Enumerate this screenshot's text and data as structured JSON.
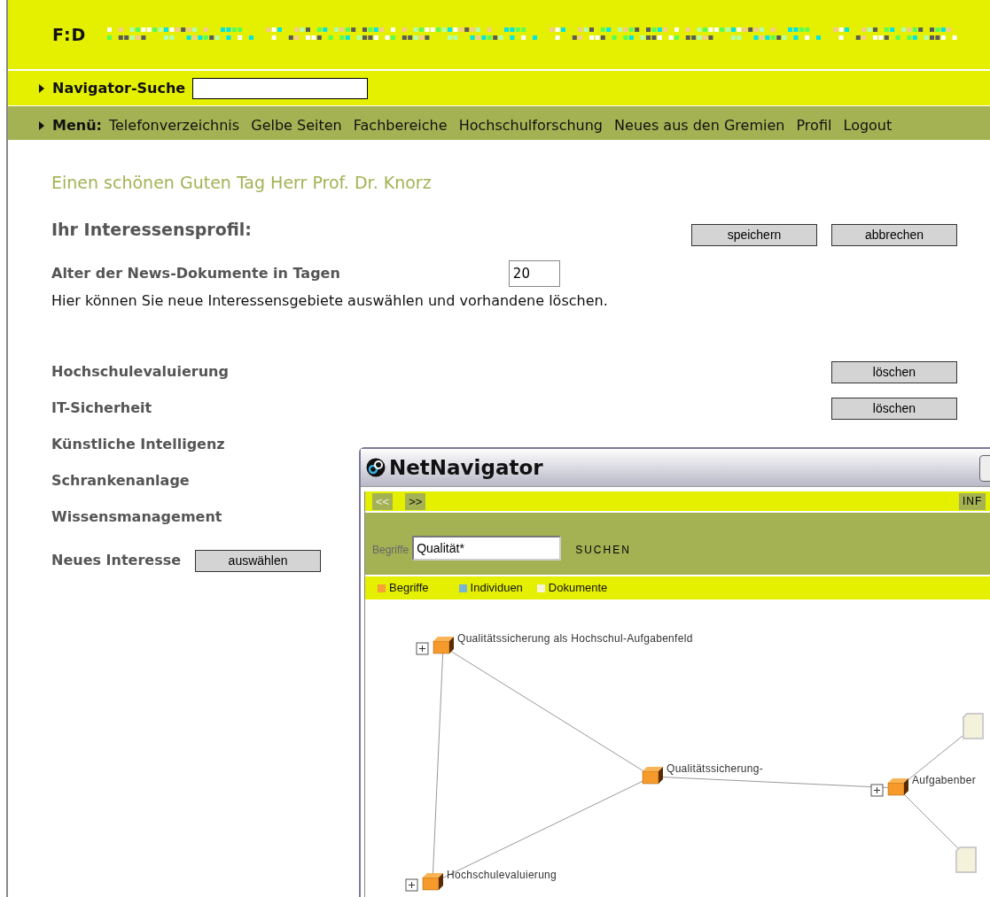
{
  "header": {
    "logo": "F:D"
  },
  "navigator_search": {
    "label": "Navigator-Suche"
  },
  "menu": {
    "label": "Menü:",
    "items": [
      "Telefonverzeichnis",
      "Gelbe Seiten",
      "Fachbereiche",
      "Hochschulforschung",
      "Neues aus den Gremien",
      "Profil",
      "Logout"
    ]
  },
  "greeting": "Einen schönen Guten Tag Herr Prof. Dr. Knorz",
  "profile": {
    "title": "Ihr Interessensprofil:",
    "buttons": [
      "speichern",
      "abbrechen"
    ],
    "age_label": "Alter der News-Dokumente in Tagen",
    "age_value": "20",
    "hint": "Hier können Sie neue Interessensgebiete auswählen und vorhandene löschen.",
    "interests": [
      {
        "label": "Hochschulevaluierung",
        "button": "löschen"
      },
      {
        "label": "IT-Sicherheit",
        "button": "löschen"
      },
      {
        "label": "Künstliche Intelligenz"
      },
      {
        "label": "Schrankenanlage"
      },
      {
        "label": "Wissensmanagement"
      }
    ],
    "new_label": "Neues Interesse",
    "new_button": "auswählen"
  },
  "net_navigator": {
    "title": "NetNavigator",
    "nav_buttons": [
      "<<",
      ">>"
    ],
    "info_button": "INF",
    "search_label": "Begriffe",
    "search_value": "Qualität*",
    "search_button": "SUCHEN",
    "legend": [
      {
        "label": "Begriffe",
        "color": "#f7a035"
      },
      {
        "label": "Individuen",
        "color": "#7ab4d4"
      },
      {
        "label": "Dokumente",
        "color": "#f7f3dc"
      }
    ],
    "nodes": [
      {
        "kind": "concept",
        "label": "Qualitätssicherung als Hochschul-Aufgabenfeld",
        "expandable": true
      },
      {
        "kind": "concept",
        "label": "Qualitätssicherung-",
        "expandable": false
      },
      {
        "kind": "concept",
        "label": "Aufgabenber",
        "expandable": true
      },
      {
        "kind": "concept",
        "label": "Hochschulevaluierung",
        "expandable": true
      },
      {
        "kind": "document"
      },
      {
        "kind": "document"
      }
    ]
  }
}
